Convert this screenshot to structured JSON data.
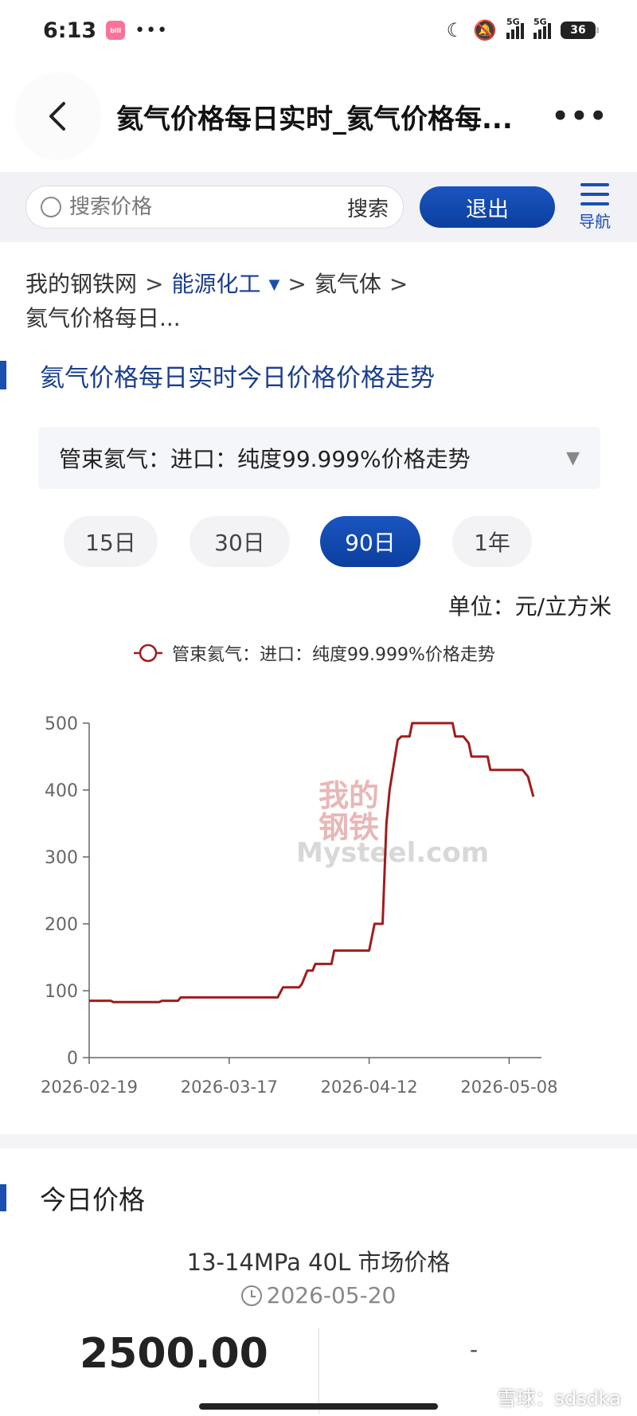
{
  "status_bar": {
    "time": "6:13",
    "app_badge": "bilibili",
    "dots": "•••",
    "signal_tags": [
      "5G",
      "5G"
    ],
    "battery": "36",
    "icons": [
      "moon-icon",
      "mute-icon"
    ]
  },
  "title_bar": {
    "title": "氦气价格每日实时_氦气价格每...",
    "more": "•••"
  },
  "search": {
    "placeholder": "搜索价格",
    "search_label": "搜索",
    "logout_label": "退出",
    "nav_label": "导航"
  },
  "breadcrumb": {
    "items": [
      "我的钢铁网",
      "能源化工",
      "氦气体",
      "氦气价格每日..."
    ],
    "separator": ">"
  },
  "section": {
    "heading": "氦气价格每日实时今日价格价格走势"
  },
  "product_select": {
    "value": "管束氦气：进口：纯度99.999%价格走势",
    "caret": "▼"
  },
  "range_tabs": [
    {
      "label": "15日",
      "active": false
    },
    {
      "label": "30日",
      "active": false
    },
    {
      "label": "90日",
      "active": true
    },
    {
      "label": "1年",
      "active": false
    }
  ],
  "unit": "单位：元/立方米",
  "chart_data": {
    "type": "line",
    "legend": "管束氦气：进口：纯度99.999%价格走势",
    "series_color": "#a01c1c",
    "watermark": [
      "我的",
      "钢铁",
      "Mysteel.com"
    ],
    "x_tick_labels": [
      "2026-02-19",
      "2026-03-17",
      "2026-04-12",
      "2026-05-08"
    ],
    "y_ticks": [
      0,
      100,
      200,
      300,
      400,
      500
    ],
    "ylim": [
      0,
      500
    ],
    "x_range_days": [
      0,
      84
    ],
    "points": [
      [
        0,
        85
      ],
      [
        4,
        85
      ],
      [
        4.5,
        83
      ],
      [
        13,
        83
      ],
      [
        13.5,
        85
      ],
      [
        16.5,
        85
      ],
      [
        17,
        90
      ],
      [
        35,
        90
      ],
      [
        36,
        105
      ],
      [
        39,
        105
      ],
      [
        39.5,
        110
      ],
      [
        40.5,
        130
      ],
      [
        41.5,
        130
      ],
      [
        42,
        140
      ],
      [
        45,
        140
      ],
      [
        45.5,
        160
      ],
      [
        52,
        160
      ],
      [
        53,
        200
      ],
      [
        54.5,
        200
      ],
      [
        55.2,
        350
      ],
      [
        55.8,
        400
      ],
      [
        56.8,
        450
      ],
      [
        57.3,
        475
      ],
      [
        58,
        480
      ],
      [
        59.5,
        480
      ],
      [
        60,
        500
      ],
      [
        67.5,
        500
      ],
      [
        68,
        480
      ],
      [
        69.5,
        480
      ],
      [
        70.5,
        470
      ],
      [
        71,
        450
      ],
      [
        74,
        450
      ],
      [
        74.5,
        430
      ],
      [
        80.5,
        430
      ],
      [
        81.5,
        420
      ],
      [
        82.5,
        390
      ]
    ]
  },
  "today_price": {
    "heading": "今日价格",
    "spec": "13-14MPa 40L 市场价格",
    "date": "2026-05-20",
    "price": "2500.00",
    "change": "-"
  },
  "footer": {
    "credit": "雪球：sdsdka"
  }
}
